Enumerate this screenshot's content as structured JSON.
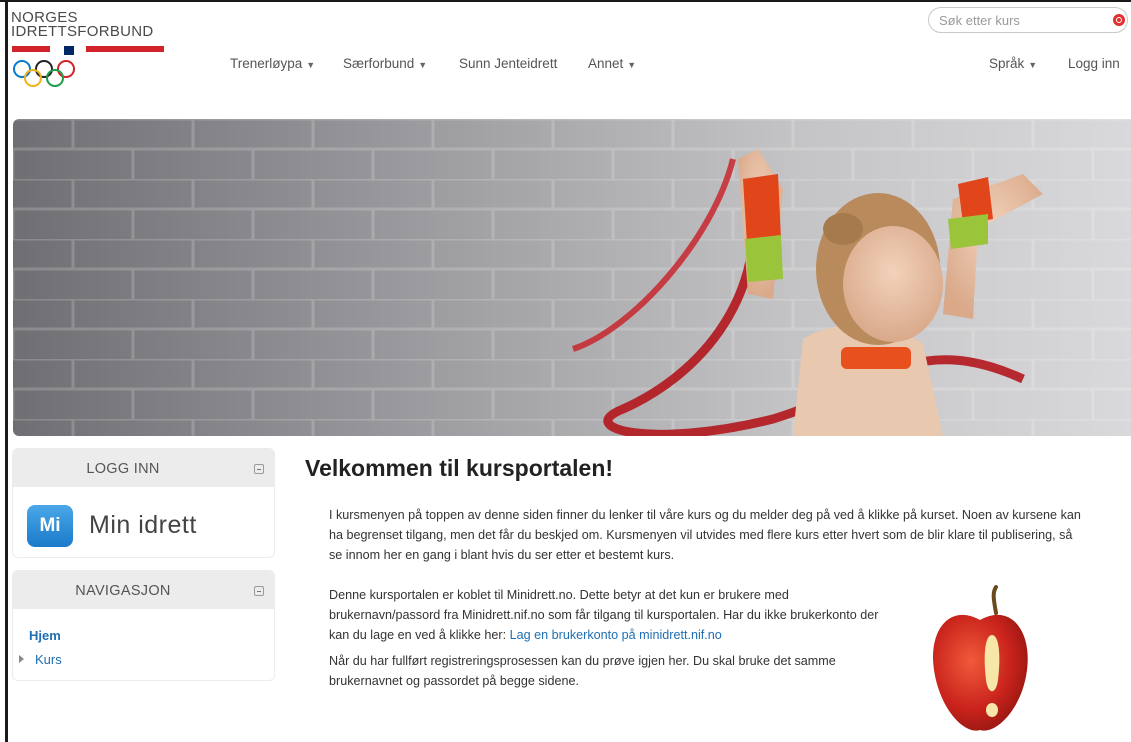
{
  "brand": {
    "line1": "NORGES",
    "line2": "IDRETTSFORBUND"
  },
  "search": {
    "placeholder": "Søk etter kurs"
  },
  "nav": {
    "items": [
      {
        "label": "Trenerløypa",
        "dropdown": true
      },
      {
        "label": "Særforbund",
        "dropdown": true
      },
      {
        "label": "Sunn Jenteidrett",
        "dropdown": false
      },
      {
        "label": "Annet",
        "dropdown": true
      }
    ],
    "language": "Språk",
    "login": "Logg inn",
    "caret": "▼"
  },
  "login_block": {
    "title": "LOGG INN",
    "logo_badge": "Mi",
    "logo_text": "Min idrett"
  },
  "nav_block": {
    "title": "NAVIGASJON",
    "home": "Hjem",
    "kurs": "Kurs"
  },
  "main": {
    "title": "Velkommen til kursportalen!",
    "p1": "I kursmenyen på toppen av denne siden finner du lenker til våre kurs og du melder deg på ved å klikke på kurset. Noen av kursene kan ha begrenset tilgang, men det får du beskjed om. Kursmenyen vil utvides med flere kurs etter hvert som de blir klare til publisering, så se innom her en gang i blant hvis du ser etter et bestemt kurs.",
    "p2_text": "Denne kursportalen er koblet til Minidrett.no. Dette betyr at det kun er brukere med brukernavn/passord fra Minidrett.nif.no som får tilgang til kursportalen. Har du ikke brukerkonto der kan du lage en ved å klikke her:",
    "p2_link": "Lag en brukerkonto på minidrett.nif.no",
    "p3": "Når du har fullført registreringsprosessen kan du prøve igjen her. Du skal bruke det samme brukernavnet og passordet på begge sidene."
  },
  "colors": {
    "link": "#1f6fb2",
    "flag_red": "#d2232a",
    "flag_blue": "#002868",
    "block_header": "#ececec"
  }
}
